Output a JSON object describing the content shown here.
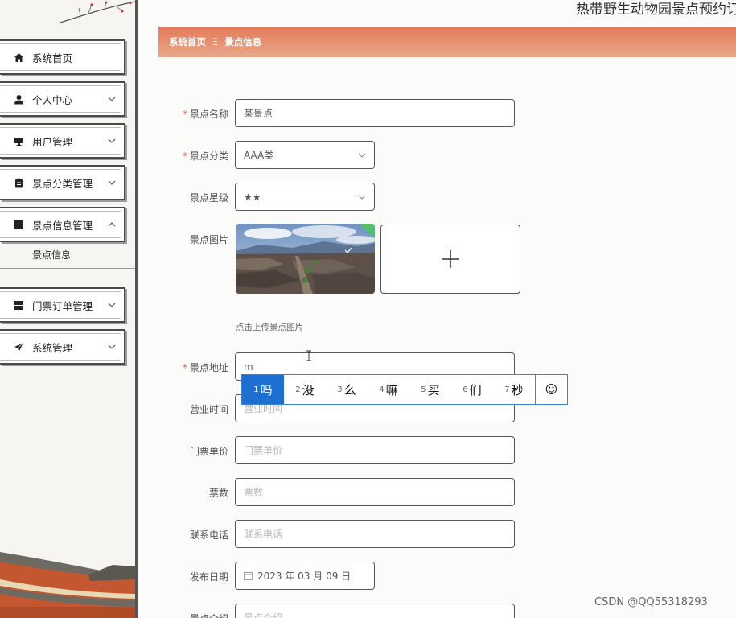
{
  "header": {
    "site_title": "热带野生动物园景点预约订",
    "breadcrumb_home": "系统首页",
    "breadcrumb_sep": "Ξ",
    "breadcrumb_current": "景点信息"
  },
  "sidebar": {
    "items": [
      {
        "label": "系统首页",
        "icon": "home-icon"
      },
      {
        "label": "个人中心",
        "icon": "person-icon"
      },
      {
        "label": "用户管理",
        "icon": "monitor-icon"
      },
      {
        "label": "景点分类管理",
        "icon": "clipboard-icon"
      },
      {
        "label": "景点信息管理",
        "icon": "grid-icon"
      },
      {
        "label": "门票订单管理",
        "icon": "grid-icon"
      },
      {
        "label": "系统管理",
        "icon": "send-icon"
      }
    ],
    "submenu": "景点信息"
  },
  "form": {
    "name_label": "景点名称",
    "name_value": "某景点",
    "category_label": "景点分类",
    "category_value": "AAA类",
    "rating_label": "景点星级",
    "rating_value": "★★",
    "image_label": "景点图片",
    "image_hint": "点击上传景点图片",
    "address_label": "景点地址",
    "address_value": "m",
    "hours_label": "营业时间",
    "hours_placeholder": "营业时间",
    "price_label": "门票单价",
    "price_placeholder": "门票单价",
    "tickets_label": "票数",
    "tickets_placeholder": "票数",
    "phone_label": "联系电话",
    "phone_placeholder": "联系电话",
    "date_label": "发布日期",
    "date_value": "2023 年 03 月 09 日",
    "intro_label": "景点介绍",
    "intro_placeholder": "景点介绍",
    "required_mark": "*"
  },
  "ime": {
    "candidates": [
      {
        "num": "1",
        "text": "吗"
      },
      {
        "num": "2",
        "text": "没"
      },
      {
        "num": "3",
        "text": "么"
      },
      {
        "num": "4",
        "text": "嘛"
      },
      {
        "num": "5",
        "text": "买"
      },
      {
        "num": "6",
        "text": "们"
      },
      {
        "num": "7",
        "text": "秒"
      }
    ],
    "emoji_label": "☺"
  },
  "watermark": "CSDN @QQ55318293",
  "colors": {
    "accent": "#e17a58",
    "ime_active": "#1d6fd1",
    "required": "#e05a4a"
  }
}
